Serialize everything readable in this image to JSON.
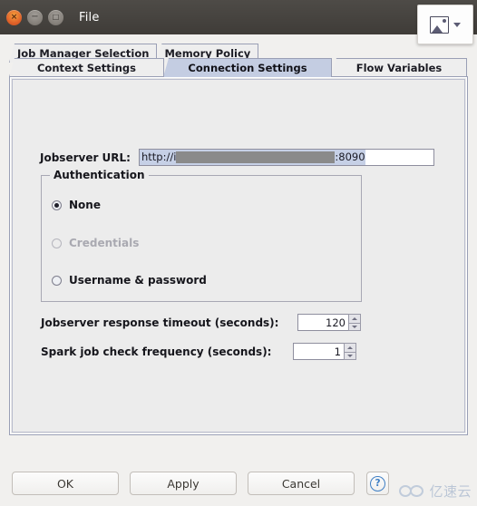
{
  "window": {
    "title": "File",
    "controls": {
      "close_label": "×",
      "minimize_label": "−",
      "maximize_label": "□"
    }
  },
  "capture_overlay": {
    "icon": "image-icon",
    "dropdown": "chevron-down-icon"
  },
  "tabs": {
    "row_top": [
      {
        "label": "Job Manager Selection",
        "selected": false
      },
      {
        "label": "Memory Policy",
        "selected": false
      }
    ],
    "row_bottom": [
      {
        "label": "Context Settings",
        "selected": false
      },
      {
        "label": "Connection Settings",
        "selected": true
      },
      {
        "label": "Flow Variables",
        "selected": false
      }
    ],
    "selected_tab": "Connection Settings",
    "selected_color": "#c4cde2"
  },
  "form": {
    "url": {
      "label": "Jobserver URL:",
      "value_prefix": "http://i",
      "value_redacted": "",
      "value_port": ":8090",
      "selection_color": "#c6d0e6",
      "redaction_color": "#8a8a8a"
    },
    "authentication": {
      "legend": "Authentication",
      "options": [
        {
          "label": "None",
          "selected": true,
          "enabled": true
        },
        {
          "label": "Credentials",
          "selected": false,
          "enabled": false
        },
        {
          "label": "Username & password",
          "selected": false,
          "enabled": true
        }
      ]
    },
    "timeout": {
      "label": "Jobserver response timeout (seconds):",
      "value": "120"
    },
    "frequency": {
      "label": "Spark job check frequency (seconds):",
      "value": "1"
    }
  },
  "buttons": {
    "ok": "OK",
    "apply": "Apply",
    "cancel": "Cancel",
    "help": "?"
  },
  "watermark": {
    "text": "亿速云"
  }
}
